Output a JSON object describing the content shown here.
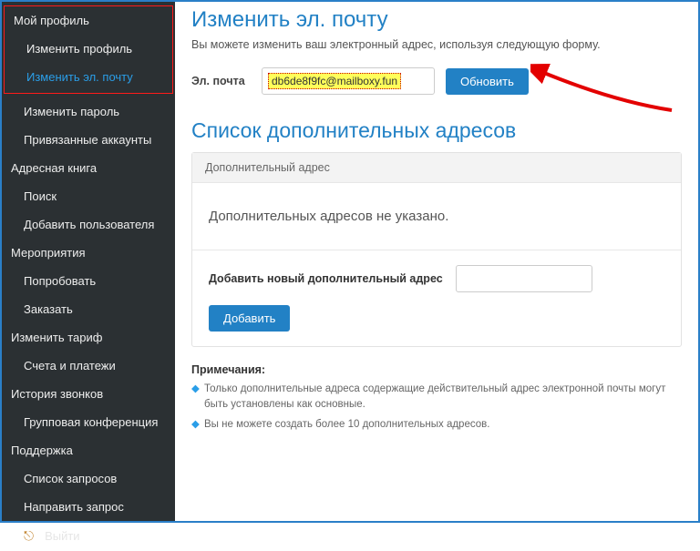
{
  "sidebar": {
    "my_profile": "Мой профиль",
    "edit_profile": "Изменить профиль",
    "edit_email": "Изменить эл. почту",
    "change_password": "Изменить пароль",
    "linked_accounts": "Привязанные аккаунты",
    "address_book": "Адресная книга",
    "search": "Поиск",
    "add_user": "Добавить пользователя",
    "events": "Мероприятия",
    "try": "Попробовать",
    "order": "Заказать",
    "change_plan": "Изменить тариф",
    "billing": "Счета и платежи",
    "call_history": "История звонков",
    "group_conference": "Групповая конференция",
    "support": "Поддержка",
    "tickets": "Список запросов",
    "new_ticket": "Направить запрос",
    "logout": "Выйти"
  },
  "main": {
    "title": "Изменить эл. почту",
    "desc": "Вы можете изменить ваш электронный адрес, используя следующую форму.",
    "email_label": "Эл. почта",
    "email_value": "db6de8f9fc@mailboxy.fun",
    "update_btn": "Обновить",
    "extra_title": "Список дополнительных адресов",
    "panel_head": "Дополнительный адрес",
    "panel_empty": "Дополнительных адресов не указано.",
    "add_label": "Добавить новый дополнительный адрес",
    "add_btn": "Добавить",
    "notes_head": "Примечания:",
    "note1": "Только дополнительные адреса содержащие действительный адрес электронной почты могут быть установлены как основные.",
    "note2": "Вы не можете создать более 10 дополнительных адресов."
  }
}
